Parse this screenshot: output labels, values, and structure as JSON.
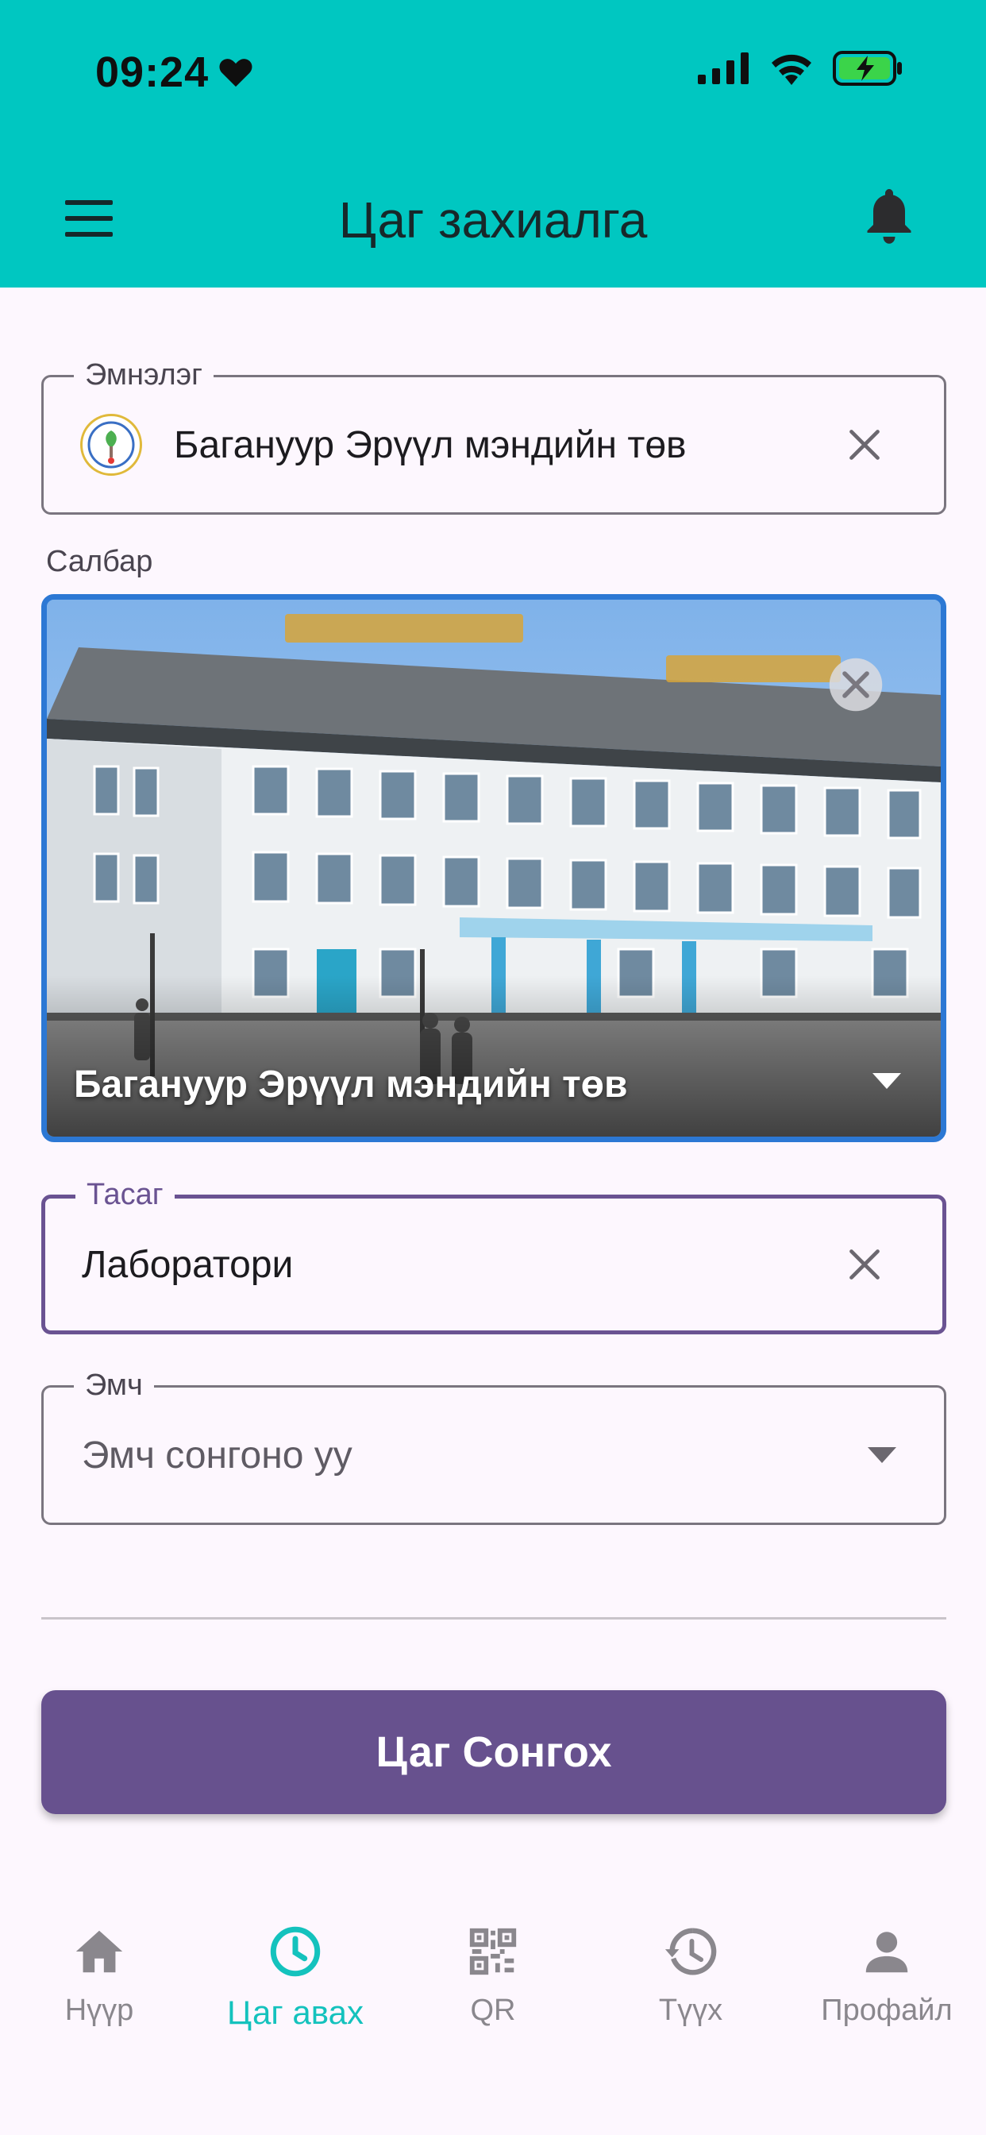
{
  "status_bar": {
    "time": "09:24"
  },
  "app_bar": {
    "title": "Цаг захиалга"
  },
  "hospital_field": {
    "label": "Эмнэлэг",
    "value": "Багануур Эрүүл мэндийн төв"
  },
  "branch": {
    "label": "Салбар",
    "name": "Багануур Эрүүл мэндийн төв"
  },
  "department_field": {
    "label": "Тасаг",
    "value": "Лаборатори"
  },
  "doctor_field": {
    "label": "Эмч",
    "placeholder": "Эмч сонгоно уу"
  },
  "primary_button": {
    "label": "Цаг Сонгох"
  },
  "bottom_nav": {
    "items": [
      {
        "label": "Нүүр",
        "icon": "home-icon"
      },
      {
        "label": "Цаг авах",
        "icon": "clock-icon"
      },
      {
        "label": "QR",
        "icon": "qr-code-icon"
      },
      {
        "label": "Түүх",
        "icon": "history-icon"
      },
      {
        "label": "Профайл",
        "icon": "person-icon"
      }
    ],
    "active_index": 1
  },
  "colors": {
    "header": "#00c7c1",
    "primary": "#67518e",
    "selected_border": "#2c78d4",
    "active_nav": "#14c2bd",
    "background": "#fdf7fe"
  }
}
